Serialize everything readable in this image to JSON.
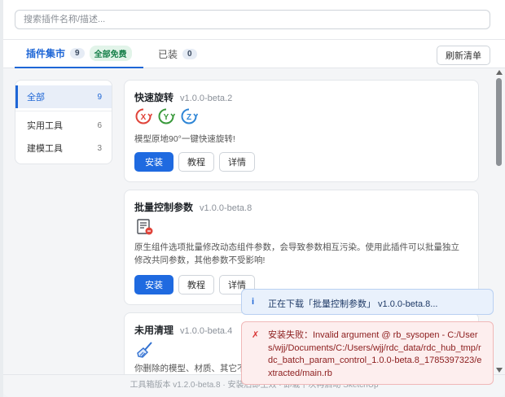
{
  "search": {
    "placeholder": "搜索插件名称/描述..."
  },
  "tabs": {
    "market": {
      "label": "插件集市",
      "count": "9",
      "badge": "全部免费"
    },
    "installed": {
      "label": "已装",
      "count": "0"
    },
    "refresh_label": "刷新清单"
  },
  "sidebar": {
    "items": [
      {
        "label": "全部",
        "count": "9",
        "active": true
      },
      {
        "label": "实用工具",
        "count": "6"
      },
      {
        "label": "建模工具",
        "count": "3"
      }
    ]
  },
  "plugins": [
    {
      "name": "快速旋转",
      "version": "v1.0.0-beta.2",
      "axis_icons": [
        "X",
        "Y",
        "Z"
      ],
      "description": "模型原地90°一键快速旋转!",
      "buttons": {
        "install": "安装",
        "tutorial": "教程",
        "details": "详情"
      }
    },
    {
      "name": "批量控制参数",
      "version": "v1.0.0-beta.8",
      "icon": "document-edit-icon",
      "description": "原生组件选项批量修改动态组件参数，会导致参数相互污染。使用此插件可以批量独立修改共同参数，其他参数不受影响!",
      "buttons": {
        "install": "安装",
        "tutorial": "教程",
        "details": "详情"
      }
    },
    {
      "name": "未用清理",
      "version": "v1.0.0-beta.4",
      "icon": "broom-icon",
      "description": "你删除的模型、材质、其它不用的东西"
    }
  ],
  "footer": {
    "text": "工具箱版本 v1.2.0-beta.8 · 安装后即生效 · 卸载下次再启动 SketchUp"
  },
  "toasts": {
    "info": {
      "icon": "i",
      "text": "正在下载「批量控制参数」 v1.0.0-beta.8..."
    },
    "error": {
      "icon": "✗",
      "text": "安装失败：Invalid argument @ rb_sysopen - C:/Users/wjj/Documents/C:/Users/wjj/rdc_data/rdc_hub_tmp/rdc_batch_param_control_1.0.0-beta.8_1785397323/extracted/main.rb"
    }
  },
  "colors": {
    "accent": "#1f6ae0",
    "axis_x": "#e0443a",
    "axis_y": "#3a9a3c",
    "axis_z": "#2f86d6",
    "free_badge": "#17804a",
    "error": "#d93636"
  }
}
